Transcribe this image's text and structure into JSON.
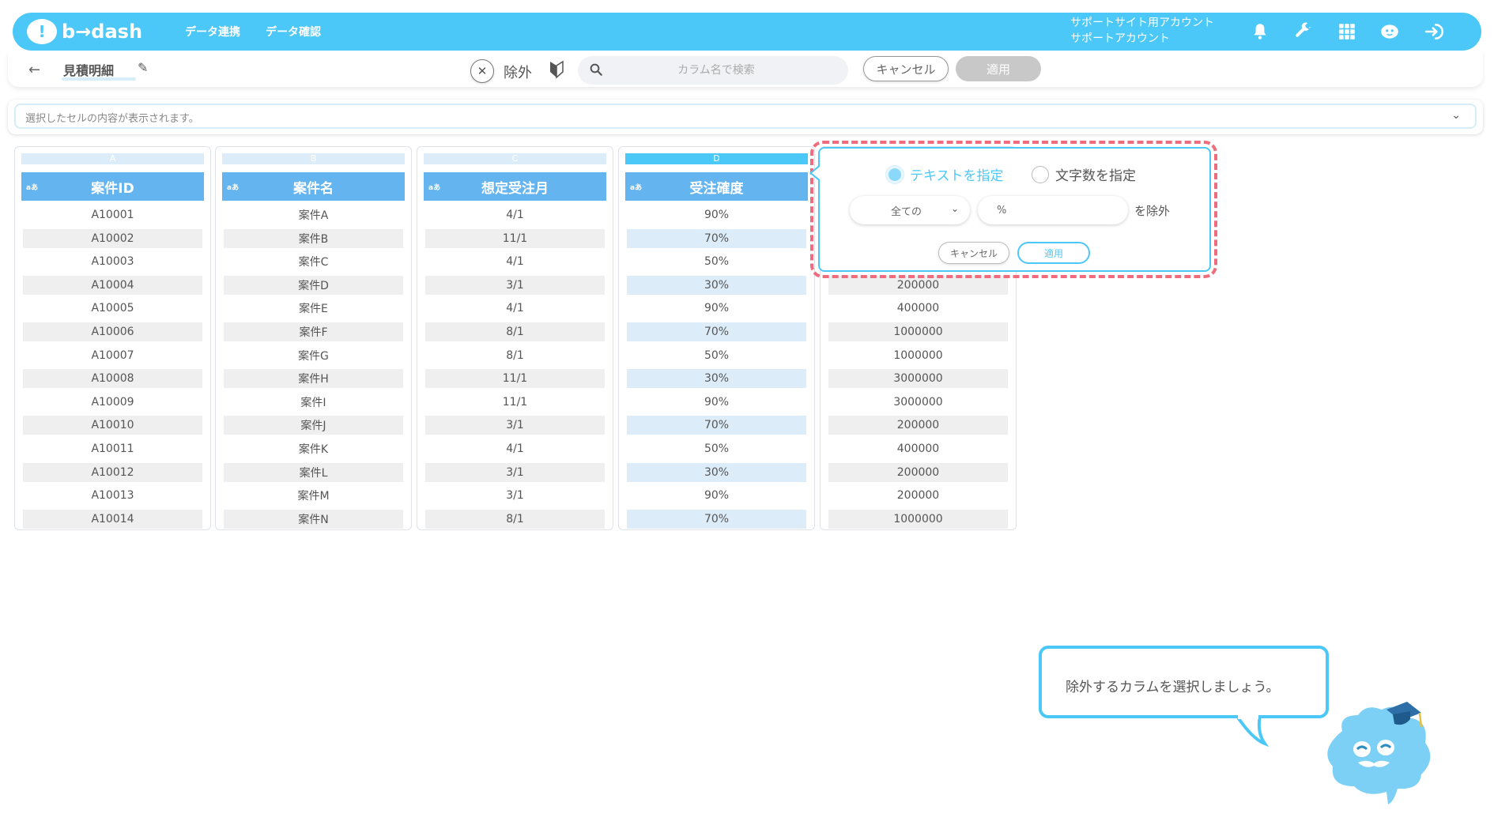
{
  "header": {
    "logo_mark": "!",
    "logo_text": "b→dash",
    "nav": [
      "データ連携",
      "データ確認"
    ],
    "account_line1": "サポートサイト用アカウント",
    "account_line2": "サポートアカウント"
  },
  "toolbar": {
    "sheet_title": "見積明細",
    "exclude_label": "除外",
    "search_placeholder": "カラム名で検索",
    "cancel_label": "キャンセル",
    "apply_label": "適用"
  },
  "cell_bar": {
    "placeholder": "選択したセルの内容が表示されます。"
  },
  "table": {
    "columns": [
      {
        "letter": "A",
        "type": "aあ",
        "name": "案件ID",
        "cells": [
          "A10001",
          "A10002",
          "A10003",
          "A10004",
          "A10005",
          "A10006",
          "A10007",
          "A10008",
          "A10009",
          "A10010",
          "A10011",
          "A10012",
          "A10013",
          "A10014"
        ]
      },
      {
        "letter": "B",
        "type": "aあ",
        "name": "案件名",
        "cells": [
          "案件A",
          "案件B",
          "案件C",
          "案件D",
          "案件E",
          "案件F",
          "案件G",
          "案件H",
          "案件I",
          "案件J",
          "案件K",
          "案件L",
          "案件M",
          "案件N"
        ]
      },
      {
        "letter": "C",
        "type": "aあ",
        "name": "想定受注月",
        "cells": [
          "4/1",
          "11/1",
          "4/1",
          "3/1",
          "4/1",
          "8/1",
          "8/1",
          "11/1",
          "11/1",
          "3/1",
          "4/1",
          "3/1",
          "3/1",
          "8/1"
        ]
      },
      {
        "letter": "D",
        "type": "aあ",
        "name": "受注確度",
        "cells": [
          "90%",
          "70%",
          "50%",
          "30%",
          "90%",
          "70%",
          "50%",
          "30%",
          "90%",
          "70%",
          "50%",
          "30%",
          "90%",
          "70%"
        ]
      },
      {
        "letter": "",
        "type": "",
        "name": "",
        "cells": [
          "",
          "",
          "",
          "200000",
          "400000",
          "1000000",
          "1000000",
          "3000000",
          "3000000",
          "200000",
          "400000",
          "200000",
          "200000",
          "1000000"
        ]
      }
    ]
  },
  "popup": {
    "radio_text_option": "テキストを指定",
    "radio_length_option": "文字数を指定",
    "select_value": "全ての",
    "input_value": "%",
    "suffix": "を除外",
    "cancel_label": "キャンセル",
    "apply_label": "適用"
  },
  "guide": {
    "message": "除外するカラムを選択しましょう。"
  },
  "colors": {
    "brand": "#4cc8f8",
    "header_cell": "#64b4f0",
    "highlight_outline": "#f06c7c"
  }
}
